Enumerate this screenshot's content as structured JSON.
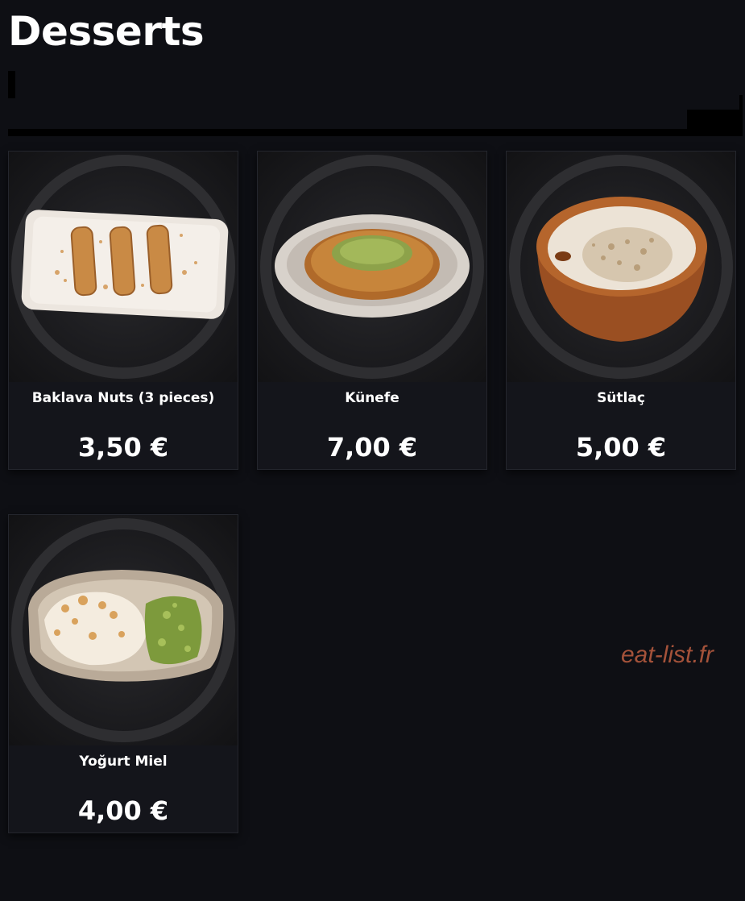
{
  "page": {
    "title": "Desserts",
    "watermark": "eat-list.fr",
    "accent_color": "#a4523a",
    "background_color": "#0e0f14"
  },
  "items": [
    {
      "name": "Baklava Nuts (3 pieces)",
      "price": "3,50 €",
      "image": "baklava-photo"
    },
    {
      "name": "Künefe",
      "price": "7,00 €",
      "image": "kunefe-photo"
    },
    {
      "name": "Sütlaç",
      "price": "5,00 €",
      "image": "sutlac-photo"
    },
    {
      "name": "Yoğurt Miel",
      "price": "4,00 €",
      "image": "yogurt-miel-photo"
    }
  ]
}
